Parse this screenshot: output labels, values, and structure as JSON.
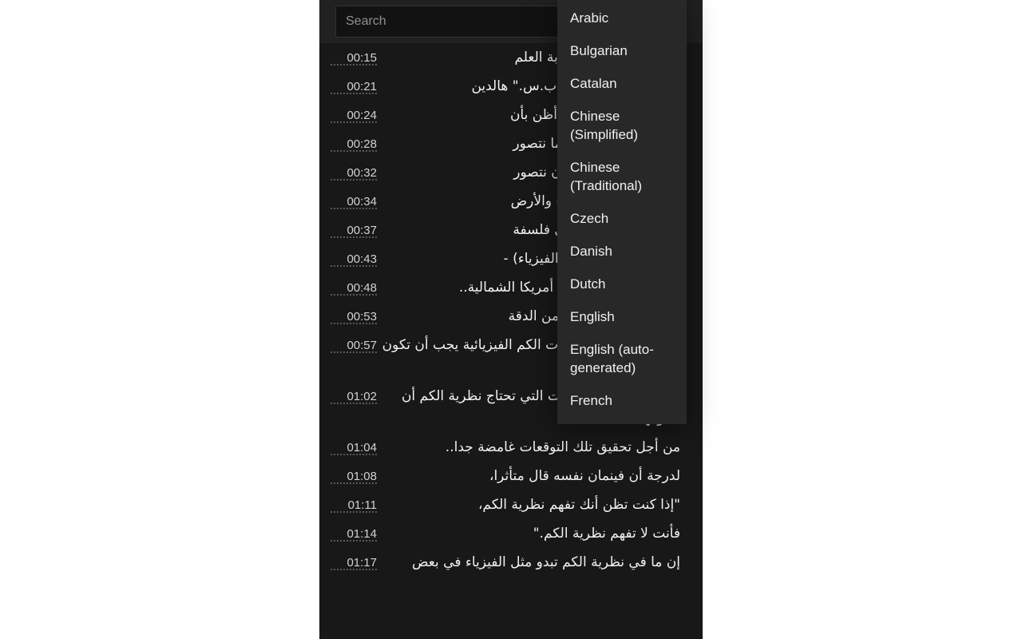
{
  "panel": {
    "background_color": "#181818",
    "header_background_color": "#212121"
  },
  "search": {
    "placeholder": "Search",
    "value": ""
  },
  "transcript": {
    "segments": [
      {
        "time": "00:15",
        "text": "ا يمكننا أن نتصور: غرابة العلم",
        "wrap": false
      },
      {
        "time": "00:21",
        "text": "ا أن نتصور\" أطلقها ج.ب.س.\" هالدين",
        "wrap": true
      },
      {
        "time": "00:24",
        "text": "هير، الذي قال، \"الآن، أظن بأن",
        "wrap": false
      },
      {
        "time": "00:28",
        "text": "ون ليس أكثر غرابة مما نتصور",
        "wrap": false
      },
      {
        "time": "00:32",
        "text": "كثر غرابة مما يمكننا أن نتصور",
        "wrap": false
      },
      {
        "time": "00:34",
        "text": "من الأشياء في السماء والأرض",
        "wrap": false
      },
      {
        "time": "00:37",
        "text": "كن أن يحلم به، في أي فلسفة",
        "wrap": false
      },
      {
        "time": "00:43",
        "text": "قة نظريات الكم (في الفيزياء) -",
        "wrap": true
      },
      {
        "time": "00:48",
        "text": "بية -- في تحديد عرض أمريكا الشمالية..",
        "wrap": true
      },
      {
        "time": "00:53",
        "text": "ر عرض شعرة واحدة من الدقة",
        "wrap": false
      },
      {
        "time": "00:57",
        "text": "وسط، يعني بأن نظريات الكم الفيزيائية يجب أن تكون صحيحة بقدر ما.",
        "wrap": true
      },
      {
        "time": "01:02",
        "text": "رغم ذلك فإن الفرضيات التي تحتاج نظرية الكم أن تسوقها..",
        "wrap": true
      },
      {
        "time": "01:04",
        "text": "من أجل تحقيق تلك التوقعات غامضة جدا..",
        "wrap": false
      },
      {
        "time": "01:08",
        "text": "لدرجة أن فينمان نفسه قال متأثرا،",
        "wrap": false
      },
      {
        "time": "01:11",
        "text": "\"إذا كنت تظن أنك تفهم نظرية الكم،",
        "wrap": false
      },
      {
        "time": "01:14",
        "text": "فأنت لا تفهم نظرية الكم.\"",
        "wrap": false
      },
      {
        "time": "01:17",
        "text": "إن ما في نظرية الكم تبدو مثل الفيزياء في بعض",
        "wrap": false
      }
    ]
  },
  "language_menu": {
    "items": [
      {
        "label": "Arabic"
      },
      {
        "label": "Bulgarian"
      },
      {
        "label": "Catalan"
      },
      {
        "label": "Chinese (Simplified)"
      },
      {
        "label": "Chinese (Traditional)"
      },
      {
        "label": "Czech"
      },
      {
        "label": "Danish"
      },
      {
        "label": "Dutch"
      },
      {
        "label": "English"
      },
      {
        "label": "English (auto-generated)"
      },
      {
        "label": "French"
      }
    ]
  }
}
